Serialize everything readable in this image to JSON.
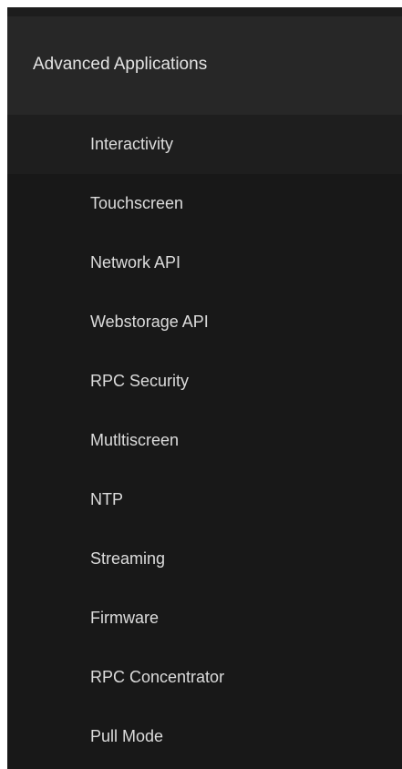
{
  "header": {
    "title": "Advanced Applications"
  },
  "menu": {
    "items": [
      {
        "label": "Interactivity"
      },
      {
        "label": "Touchscreen"
      },
      {
        "label": "Network API"
      },
      {
        "label": "Webstorage API"
      },
      {
        "label": "RPC Security"
      },
      {
        "label": "Mutltiscreen"
      },
      {
        "label": "NTP"
      },
      {
        "label": "Streaming"
      },
      {
        "label": "Firmware"
      },
      {
        "label": "RPC Concentrator"
      },
      {
        "label": "Pull Mode"
      }
    ]
  },
  "colors": {
    "panel_background": "#181818",
    "header_background": "#272727",
    "active_item_background": "#1e1e1e",
    "text": "#dcdcdc"
  }
}
